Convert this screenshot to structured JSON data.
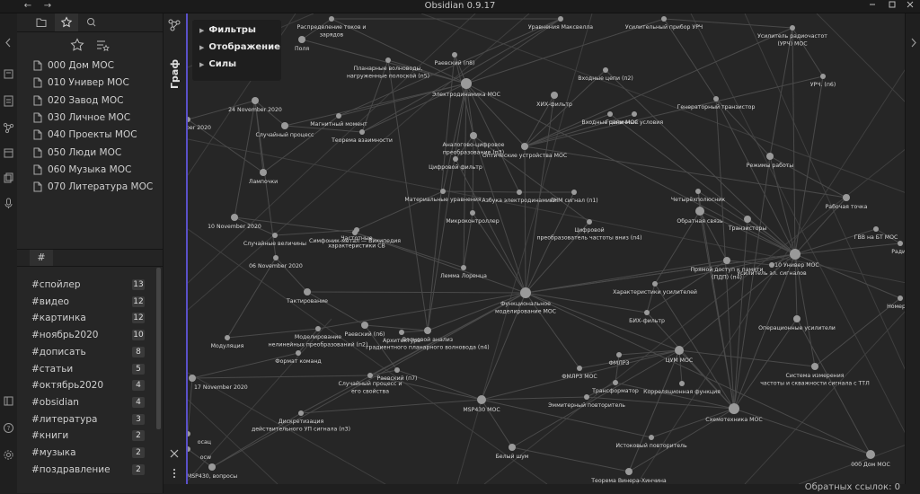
{
  "window": {
    "title": "Obsidian 0.9.17",
    "back_glyph": "←",
    "forward_glyph": "→"
  },
  "sidebar": {
    "starred": [
      "000 Дом МОС",
      "010 Универ МОС",
      "020 Завод МОС",
      "030 Личное МОС",
      "040 Проекты МОС",
      "050 Люди МОС",
      "060 Музыка МОС",
      "070 Литература МОС"
    ],
    "tag_tab_label": "#",
    "tags": [
      {
        "name": "#спойлер",
        "count": "13"
      },
      {
        "name": "#видео",
        "count": "12"
      },
      {
        "name": "#картинка",
        "count": "12"
      },
      {
        "name": "#ноябрь2020",
        "count": "10"
      },
      {
        "name": "#дописать",
        "count": "8"
      },
      {
        "name": "#статьи",
        "count": "5"
      },
      {
        "name": "#октябрь2020",
        "count": "4"
      },
      {
        "name": "#obsidian",
        "count": "4"
      },
      {
        "name": "#литература",
        "count": "3"
      },
      {
        "name": "#книги",
        "count": "2"
      },
      {
        "name": "#музыка",
        "count": "2"
      },
      {
        "name": "#поздравление",
        "count": "2"
      }
    ]
  },
  "graph": {
    "title": "Граф",
    "controls": {
      "filters": "Фильтры",
      "display": "Отображение",
      "forces": "Силы"
    },
    "nodes": [
      {
        "id": "n1",
        "label": "Распределение токов и зарядов"
      },
      {
        "id": "n2",
        "label": "Уравнения Максвелла"
      },
      {
        "id": "n3",
        "label": "Усилительный прибор УРЧ"
      },
      {
        "id": "n4",
        "label": "Поля"
      },
      {
        "id": "n5",
        "label": "Усилитель радиочастот (УРЧ) МОС"
      },
      {
        "id": "n6",
        "label": "Раевский (п8)"
      },
      {
        "id": "n7",
        "label": "Планарные волноводы, нагруженные полоской (п5)"
      },
      {
        "id": "n8",
        "label": "Входные цепи (п2)"
      },
      {
        "id": "n9",
        "label": "УРЧ. (п6)"
      },
      {
        "id": "n10",
        "label": "Электродинамика МОС"
      },
      {
        "id": "n11",
        "label": "ХИХ-фильтр"
      },
      {
        "id": "n12",
        "label": "Генераторный транзистор"
      },
      {
        "id": "n13",
        "label": "24 November 2020"
      },
      {
        "id": "n14",
        "label": "Входные цепи МОС"
      },
      {
        "id": "n15",
        "label": "Граничные условия"
      },
      {
        "id": "n16",
        "label": "ber 2020"
      },
      {
        "id": "n17",
        "label": "Магнитный момент"
      },
      {
        "id": "n18",
        "label": "Случайный процесс"
      },
      {
        "id": "n19",
        "label": "Теорема взаимности"
      },
      {
        "id": "n20",
        "label": "Аналогово-цифровое преобразование (п3)"
      },
      {
        "id": "n21",
        "label": "Оптические устройства МОС"
      },
      {
        "id": "n22",
        "label": "Режимы работы"
      },
      {
        "id": "n23",
        "label": "Цифровой фильтр"
      },
      {
        "id": "n24",
        "label": "Лампочки"
      },
      {
        "id": "n25",
        "label": "Материальные уравнения"
      },
      {
        "id": "n26",
        "label": "Азбука электродинамики"
      },
      {
        "id": "n27",
        "label": "ЛЧМ сигнал (п1)"
      },
      {
        "id": "n28",
        "label": "Четырёхполюсник"
      },
      {
        "id": "n29",
        "label": "Рабочая точка"
      },
      {
        "id": "n30",
        "label": "Микроконтроллер"
      },
      {
        "id": "n31",
        "label": "10 November 2020"
      },
      {
        "id": "n32",
        "label": "Частотные характеристики СВ"
      },
      {
        "id": "n33",
        "label": "Цифровой преобразователь частоты вниз (п4)"
      },
      {
        "id": "n34",
        "label": "Обратная связь"
      },
      {
        "id": "n35",
        "label": "Транзисторы"
      },
      {
        "id": "n36",
        "label": "Симфоник-метал — Википедия"
      },
      {
        "id": "n37",
        "label": "ГВВ на БТ МОС"
      },
      {
        "id": "n38",
        "label": "Случайные величины"
      },
      {
        "id": "n39",
        "label": "Радио"
      },
      {
        "id": "n40",
        "label": "06 November 2020"
      },
      {
        "id": "n41",
        "label": "Прямой доступ к памяти (ПДП) (п4)"
      },
      {
        "id": "n42",
        "label": "010 Универ МОС"
      },
      {
        "id": "n43",
        "label": "Лемма Лоренца"
      },
      {
        "id": "n44",
        "label": "Усилитель эл. сигналов"
      },
      {
        "id": "n45",
        "label": "Тактирование"
      },
      {
        "id": "n46",
        "label": "Функциональное моделирование МОС"
      },
      {
        "id": "n47",
        "label": "Характеристики усилителей"
      },
      {
        "id": "n48",
        "label": "Номер ст"
      },
      {
        "id": "n49",
        "label": "БИХ-фильтр"
      },
      {
        "id": "n50",
        "label": "Операционные усилители"
      },
      {
        "id": "n51",
        "label": "Моделирование нелинейных преобразований (п2)"
      },
      {
        "id": "n52",
        "label": "Раевский (п6)"
      },
      {
        "id": "n53",
        "label": "Архитектура"
      },
      {
        "id": "n54",
        "label": "Волновой анализ градиентного планарного волновода (п4)"
      },
      {
        "id": "n55",
        "label": "Модуляция"
      },
      {
        "id": "n56",
        "label": "Формат команд"
      },
      {
        "id": "n57",
        "label": "ЦУМ МОС"
      },
      {
        "id": "n58",
        "label": "ФМЛРЗ"
      },
      {
        "id": "n59",
        "label": "ФМЛРЗ МОС"
      },
      {
        "id": "n60",
        "label": "Система измерения частоты и скважности сигнала с ТТЛ"
      },
      {
        "id": "n61",
        "label": "Раевский (п7)"
      },
      {
        "id": "n62",
        "label": "Случайный процесс и его свойства"
      },
      {
        "id": "n63",
        "label": "17 November 2020"
      },
      {
        "id": "n64",
        "label": "Трансформатор"
      },
      {
        "id": "n65",
        "label": "Корреляционная функция"
      },
      {
        "id": "n66",
        "label": "MSP430 МОС"
      },
      {
        "id": "n67",
        "label": "Эммитерный повторитель"
      },
      {
        "id": "n68",
        "label": "Схемотехника МОС"
      },
      {
        "id": "n69",
        "label": "Дискретизация действительного УП сигнала (п3)"
      },
      {
        "id": "n70",
        "label": "Истоковый повторитель"
      },
      {
        "id": "n71",
        "label": "Белый шум"
      },
      {
        "id": "n72",
        "label": "000 Дом МОС"
      },
      {
        "id": "n73",
        "label": "MSP430, вопросы"
      },
      {
        "id": "n74",
        "label": "Теорема Винера-Хинчина"
      },
      {
        "id": "n75",
        "label": "ocw"
      },
      {
        "id": "n76",
        "label": "ocац"
      }
    ]
  },
  "status": {
    "backlinks": "Обратных ссылок: 0"
  }
}
